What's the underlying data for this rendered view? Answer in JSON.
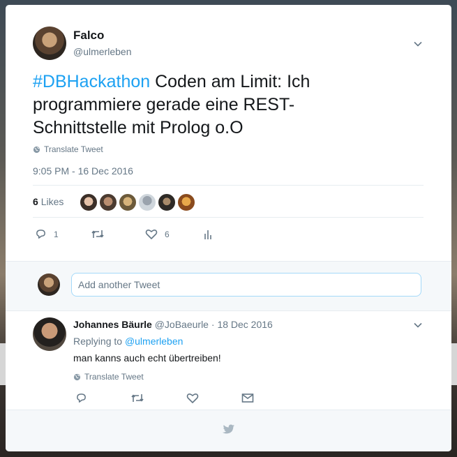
{
  "tweet": {
    "author_name": "Falco",
    "author_handle": "@ulmerleben",
    "hashtag": "#DBHackathon",
    "text": " Coden am Limit: Ich programmiere gerade eine REST-Schnittstelle mit Prolog o.O",
    "translate_label": "Translate Tweet",
    "timestamp": "9:05 PM - 16 Dec 2016",
    "likes_count": "6",
    "likes_label": "Likes",
    "reply_count": "1",
    "like_count": "6"
  },
  "composer": {
    "placeholder": "Add another Tweet"
  },
  "reply": {
    "author_name": "Johannes Bäurle",
    "author_handle": "@JoBaeurle",
    "separator": " · ",
    "date": "18 Dec 2016",
    "replying_prefix": "Replying to ",
    "replying_to": "@ulmerleben",
    "text": "man kanns auch echt übertreiben!",
    "translate_label": "Translate Tweet"
  },
  "colors": {
    "accent": "#1da1f2",
    "muted": "#657786",
    "text": "#14171a",
    "divider": "#e6ecf0"
  },
  "icons": [
    "chevron-down-icon",
    "globe-icon",
    "reply-icon",
    "retweet-icon",
    "heart-icon",
    "analytics-icon",
    "mail-icon",
    "twitter-bird-icon"
  ]
}
